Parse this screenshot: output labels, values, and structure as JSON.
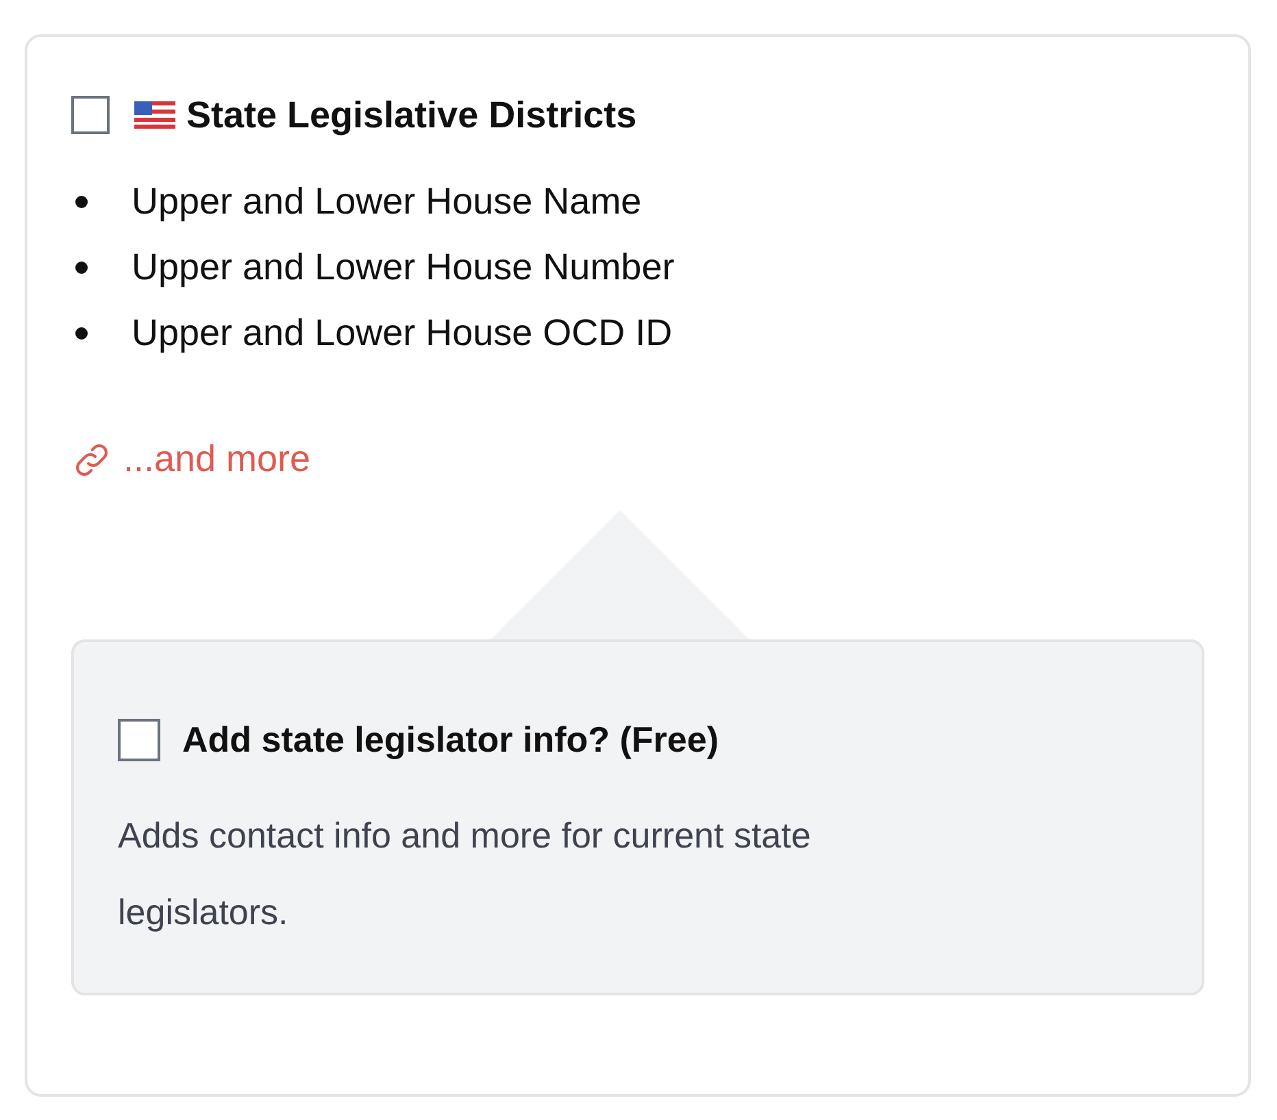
{
  "option": {
    "checked": false,
    "title": "State Legislative Districts"
  },
  "fields": [
    "Upper and Lower House Name",
    "Upper and Lower House Number",
    "Upper and Lower House OCD ID"
  ],
  "more_link": "...and more",
  "addon": {
    "checked": false,
    "label": "Add state legislator info? (Free)",
    "description": "Adds contact info and more for current state legislators."
  }
}
